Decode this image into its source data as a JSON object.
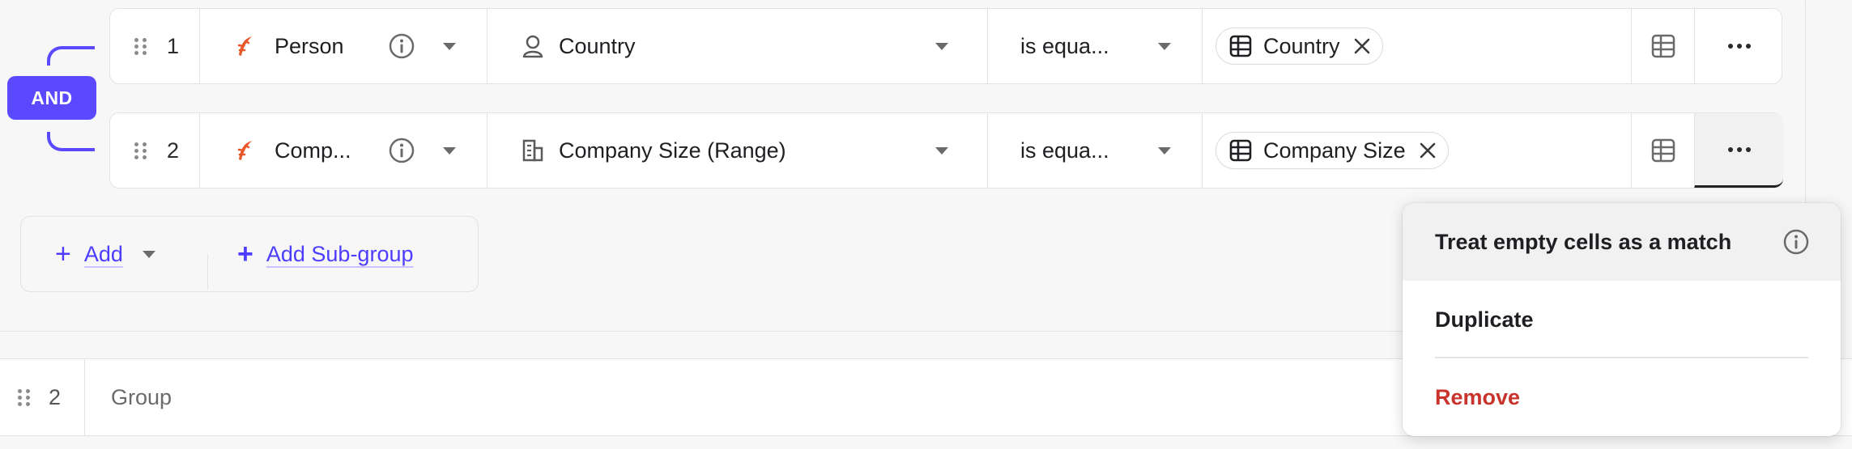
{
  "logic": {
    "operator": "AND"
  },
  "rows": [
    {
      "index": "1",
      "source": "Person",
      "field": "Country",
      "operator": "is equa...",
      "value": "Country"
    },
    {
      "index": "2",
      "source": "Comp...",
      "field": "Company Size (Range)",
      "operator": "is equa...",
      "value": "Company Size"
    }
  ],
  "actions": {
    "add_label": "Add",
    "add_subgroup_label": "Add Sub-group"
  },
  "group": {
    "index": "2",
    "label": "Group"
  },
  "menu": {
    "items": [
      {
        "label": "Treat empty cells as a match"
      },
      {
        "label": "Duplicate"
      },
      {
        "label": "Remove"
      }
    ]
  },
  "colors": {
    "accent": "#5b49ff",
    "danger": "#c8332b",
    "source_icon": "#e8562a"
  },
  "icons": {
    "drag": "drag-handle-icon",
    "source": "feather-icon",
    "info": "info-icon",
    "person": "person-icon",
    "building": "building-icon",
    "table": "table-icon",
    "remove": "close-icon",
    "more": "more-icon",
    "plus": "plus-icon"
  }
}
